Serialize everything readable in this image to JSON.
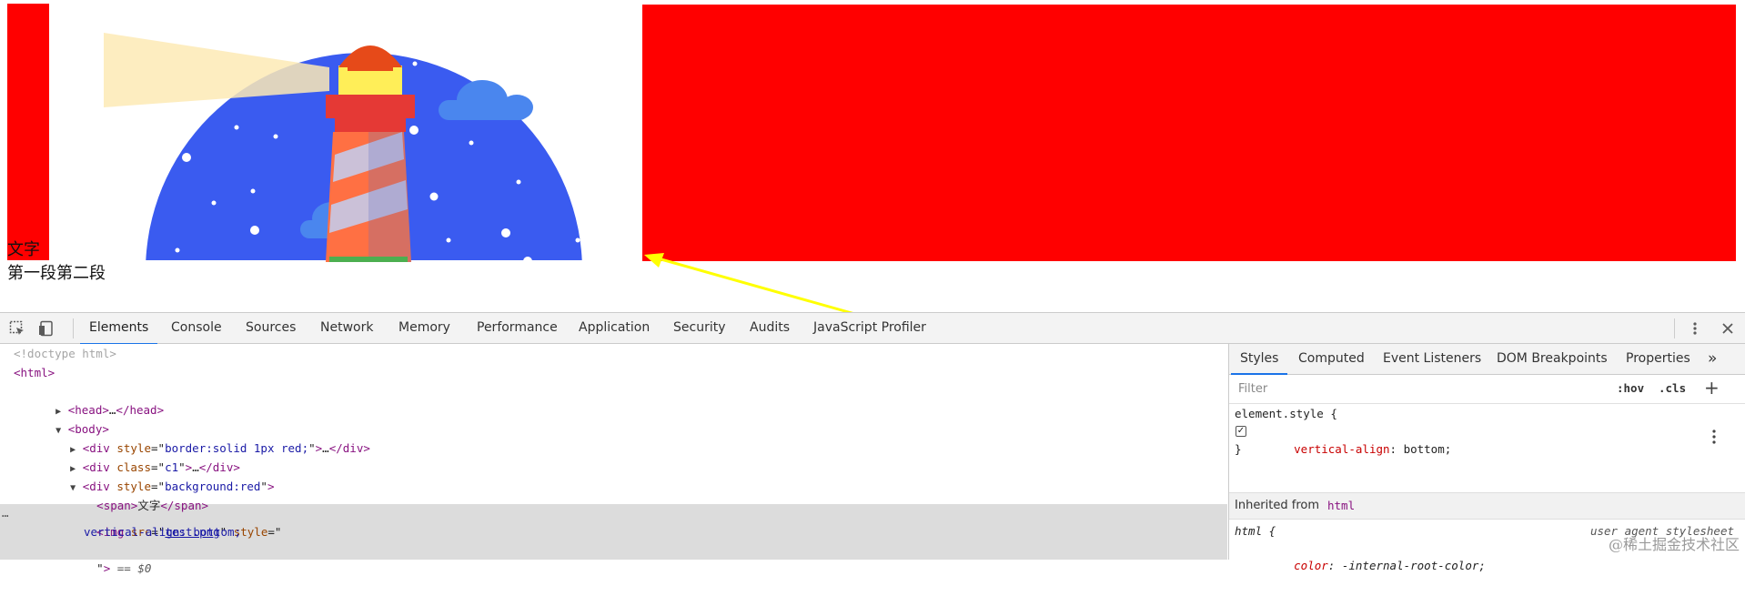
{
  "page": {
    "span_text": "文字",
    "paragraph_text": "第一段第二段",
    "accent_red": "#ff0000"
  },
  "devtools": {
    "tabs": [
      "Elements",
      "Console",
      "Sources",
      "Network",
      "Memory",
      "Performance",
      "Application",
      "Security",
      "Audits",
      "JavaScript Profiler"
    ],
    "active_tab": "Elements",
    "elements": {
      "doctype": "<!doctype html>",
      "html_open": "<html>",
      "head_tag": "head",
      "head_collapsed": "…",
      "body_tag": "body",
      "div1_tag": "div",
      "div1_attr": "style",
      "div1_val": "border:solid 1px red;",
      "div2_tag": "div",
      "div2_attr": "class",
      "div2_val": "c1",
      "div3_tag": "div",
      "div3_attr": "style",
      "div3_val": "background:red",
      "span_tag": "span",
      "span_text": "文字",
      "img_tag": "img",
      "img_src_attr": "src",
      "img_src_val": "test.png",
      "img_style_attr": "style",
      "img_style_val": "vertical-align: bottom;",
      "dollar_ref": "== $0",
      "ellipsis": "…"
    },
    "styles_pane": {
      "tabs": [
        "Styles",
        "Computed",
        "Event Listeners",
        "DOM Breakpoints",
        "Properties"
      ],
      "active_tab": "Styles",
      "more_tabs": "»",
      "filter_placeholder": "Filter",
      "hov": ":hov",
      "cls": ".cls",
      "add": "+",
      "element_style_selector": "element.style {",
      "property_name": "vertical-align",
      "property_value": "bottom;",
      "close_brace": "}",
      "inherited_label": "Inherited from",
      "inherited_tag": "html",
      "ua_selector": "html {",
      "ua_source": "user agent stylesheet",
      "ua_property": "color",
      "ua_value": "-internal-root-color;"
    }
  },
  "watermark": "@稀土掘金技术社区"
}
